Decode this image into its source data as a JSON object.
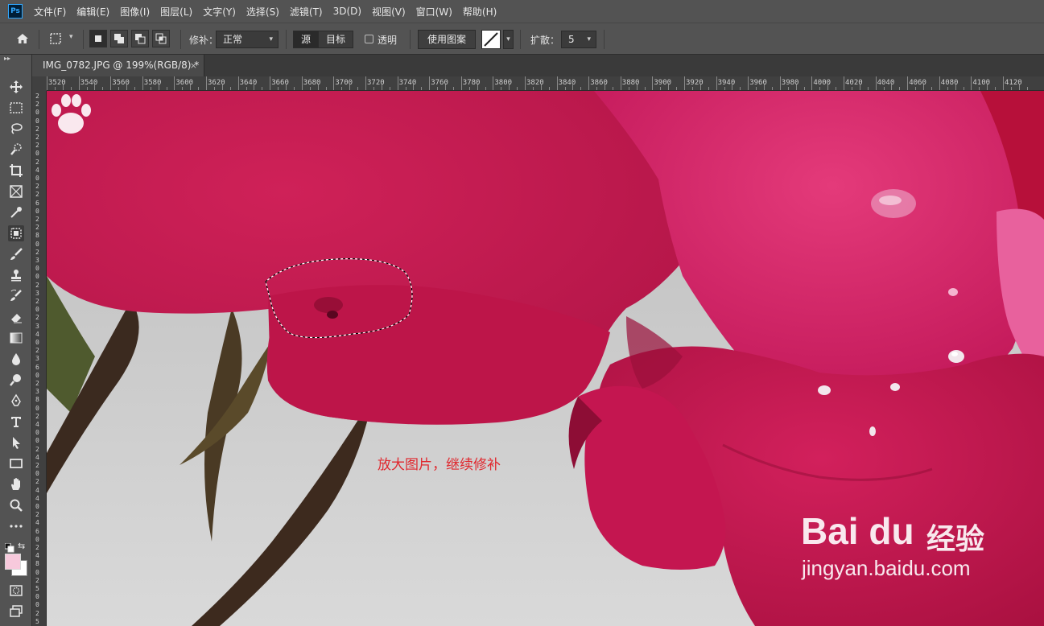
{
  "app": {
    "logo": "Ps",
    "menu": [
      "文件(F)",
      "编辑(E)",
      "图像(I)",
      "图层(L)",
      "文字(Y)",
      "选择(S)",
      "滤镜(T)",
      "3D(D)",
      "视图(V)",
      "窗口(W)",
      "帮助(H)"
    ]
  },
  "options": {
    "patch_label": "修补：",
    "patch_mode": "正常",
    "source_label": "源",
    "target_label": "目标",
    "transparent_label": "透明",
    "use_pattern_label": "使用图案",
    "diffusion_label": "扩散：",
    "diffusion_value": "5"
  },
  "document": {
    "tab_title": "IMG_0782.JPG @ 199%(RGB/8) *",
    "close": "×"
  },
  "ruler": {
    "top_labels": [
      "3520",
      "3540",
      "3560",
      "3580",
      "3600",
      "3620",
      "3640",
      "3660",
      "3680",
      "3700",
      "3720",
      "3740",
      "3760",
      "3780",
      "3800",
      "3820",
      "3840",
      "3860",
      "3880",
      "3900",
      "3920",
      "3940",
      "3960",
      "3980",
      "4000",
      "4020",
      "4040",
      "4060",
      "4080",
      "4100",
      "4120"
    ],
    "left_digits": [
      "2",
      "2",
      "0",
      "0",
      "2",
      "2",
      "2",
      "0",
      "2",
      "4",
      "0",
      "2",
      "2",
      "6",
      "0",
      "2",
      "2",
      "8",
      "0",
      "2",
      "3",
      "0",
      "0",
      "2",
      "3",
      "2",
      "0",
      "2",
      "3",
      "4",
      "0",
      "2",
      "3",
      "6",
      "0",
      "2",
      "3",
      "8",
      "0",
      "2",
      "4",
      "0",
      "0",
      "2",
      "4",
      "2",
      "0",
      "2",
      "4",
      "4",
      "0",
      "2",
      "4",
      "6",
      "0",
      "2",
      "4",
      "8",
      "0",
      "2",
      "5",
      "0",
      "0",
      "2",
      "5",
      "2"
    ]
  },
  "canvas": {
    "annotation": "放大图片，继续修补",
    "watermark_logo": "Bai   du",
    "watermark_cn": "经验",
    "watermark_url": "jingyan.baidu.com"
  },
  "colors": {
    "petal": "#c8184f",
    "petal_light": "#d92a6a",
    "background": "#c4c4c4",
    "stem": "#3d2a1e",
    "annotation": "#e0282e"
  }
}
